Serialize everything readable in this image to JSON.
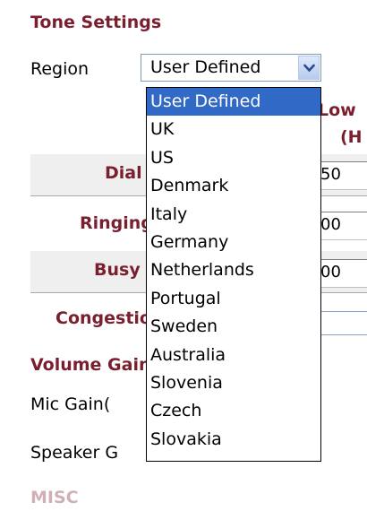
{
  "tone_settings": {
    "heading": "Tone Settings",
    "region_label": "Region",
    "region_selected": "User Defined",
    "region_options": [
      "User Defined",
      "UK",
      "US",
      "Denmark",
      "Italy",
      "Germany",
      "Netherlands",
      "Portugal",
      "Sweden",
      "Australia",
      "Slovenia",
      "Czech",
      "Slovakia"
    ],
    "col_header_1": "Low",
    "col_header_2": "(H",
    "rows": [
      {
        "label": "Dial",
        "value": "50"
      },
      {
        "label": "Ringing",
        "value": "00"
      },
      {
        "label": "Busy",
        "value": "00"
      },
      {
        "label": "Congestion",
        "value": ""
      }
    ]
  },
  "volume": {
    "heading": "Volume Gain",
    "mic_label": "Mic Gain(",
    "speaker_label": "Speaker G"
  },
  "misc": {
    "heading": "MISC"
  }
}
